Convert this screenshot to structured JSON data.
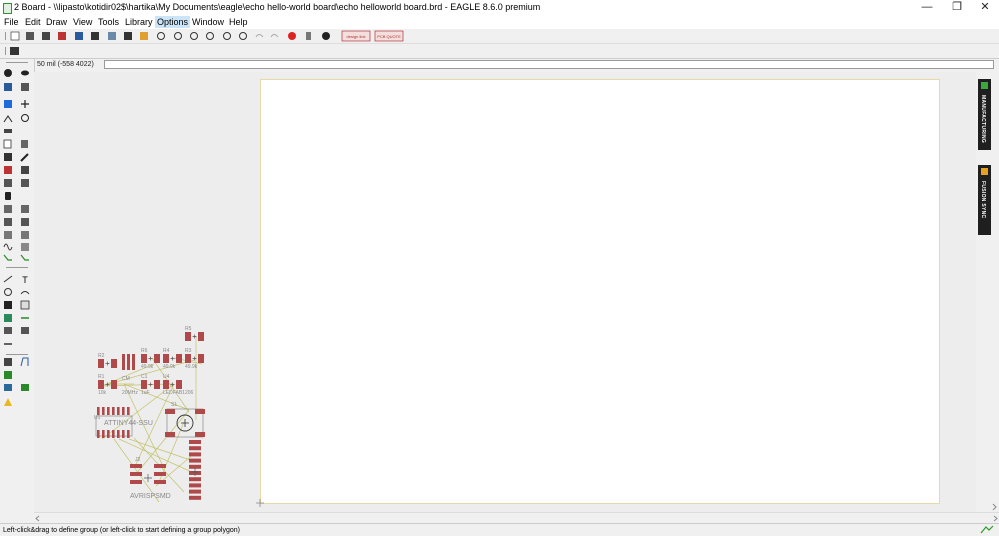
{
  "window": {
    "title": "2 Board - \\\\lipasto\\kotidir02$\\hartika\\My Documents\\eagle\\echo hello-world board\\echo helloworld board.brd - EAGLE 8.6.0 premium",
    "minimize": "—",
    "restore": "❐",
    "close": "✕"
  },
  "menu": [
    "File",
    "Edit",
    "Draw",
    "View",
    "Tools",
    "Library",
    "Options",
    "Window",
    "Help"
  ],
  "command": {
    "coord": "50 mil (-558 4022)",
    "value": ""
  },
  "status": {
    "message": "Left-click&drag to define group (or left-click to start defining a group polygon)"
  },
  "panels": {
    "manufacturing": "MANUFACTURING",
    "fusion_sync": "FUSION SYNC"
  },
  "toolbar": {
    "design_link": "design link",
    "pcb_quote": "PCB QUOTE"
  },
  "colors": {
    "pad": "#b04a4a",
    "airwire": "#c4c26b",
    "silk": "#8a8a8a",
    "board_outline": "#e6d9a8"
  },
  "components": {
    "r1": {
      "name": "R1",
      "value": "10k"
    },
    "r2": {
      "name": "R2",
      "value": ""
    },
    "r3": {
      "name": "R3",
      "value": "49.9k"
    },
    "r4": {
      "name": "R4",
      "value": "49.9k"
    },
    "r5": {
      "name": "R5",
      "value": ""
    },
    "r6": {
      "name": "R6",
      "value": "49.9k"
    },
    "c1": {
      "name": "C1",
      "value": "1uF"
    },
    "u1": {
      "name": "U1",
      "value": "ATTINY44-SSU"
    },
    "u4": {
      "name": "U4",
      "value": "LEDFAB1206"
    },
    "s1": {
      "name": "S1",
      "value": ""
    },
    "j2": {
      "name": "J2",
      "value": "AVRISPSMD"
    },
    "cm": {
      "name": "CM",
      "value": "20MHz"
    }
  }
}
